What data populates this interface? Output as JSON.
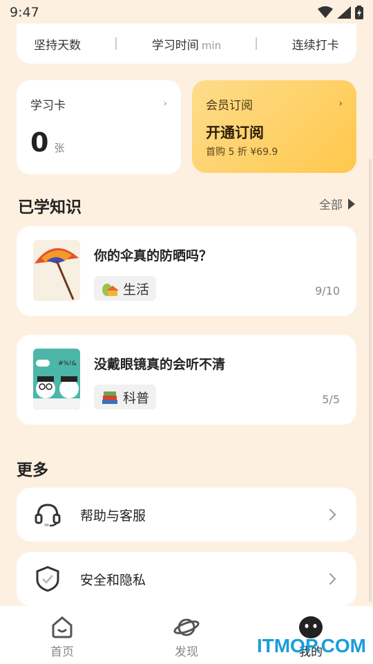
{
  "status_bar": {
    "time": "9:47"
  },
  "stats": {
    "item1": "坚持天数",
    "item2": "学习时间",
    "item2_unit": "min",
    "item3": "连续打卡"
  },
  "study_card": {
    "title": "学习卡",
    "count": "0",
    "unit": "张",
    "chevron": "›"
  },
  "vip_card": {
    "title": "会员订阅",
    "headline": "开通订阅",
    "subtitle": "首购 5 折 ¥69.9",
    "chevron": "›"
  },
  "learned": {
    "title": "已学知识",
    "see_all": "全部",
    "items": [
      {
        "title": "你的伞真的防晒吗？",
        "tag": "生活",
        "progress": "9/10"
      },
      {
        "title": "没戴眼镜真的会听不清",
        "tag": "科普",
        "progress": "5/5"
      }
    ]
  },
  "more": {
    "title": "更多",
    "items": [
      {
        "label": "帮助与客服",
        "icon": "headset-icon"
      },
      {
        "label": "安全和隐私",
        "icon": "shield-icon"
      }
    ]
  },
  "nav": {
    "items": [
      {
        "label": "首页",
        "icon": "home-icon"
      },
      {
        "label": "发现",
        "icon": "planet-icon"
      },
      {
        "label": "我的",
        "icon": "profile-icon"
      }
    ]
  },
  "watermark": "ITMOP.COM",
  "colors": {
    "background": "#fdf0e0",
    "vip_gradient_start": "#fedc8c",
    "vip_gradient_end": "#ffc84c",
    "watermark": "#1a9dd9"
  }
}
